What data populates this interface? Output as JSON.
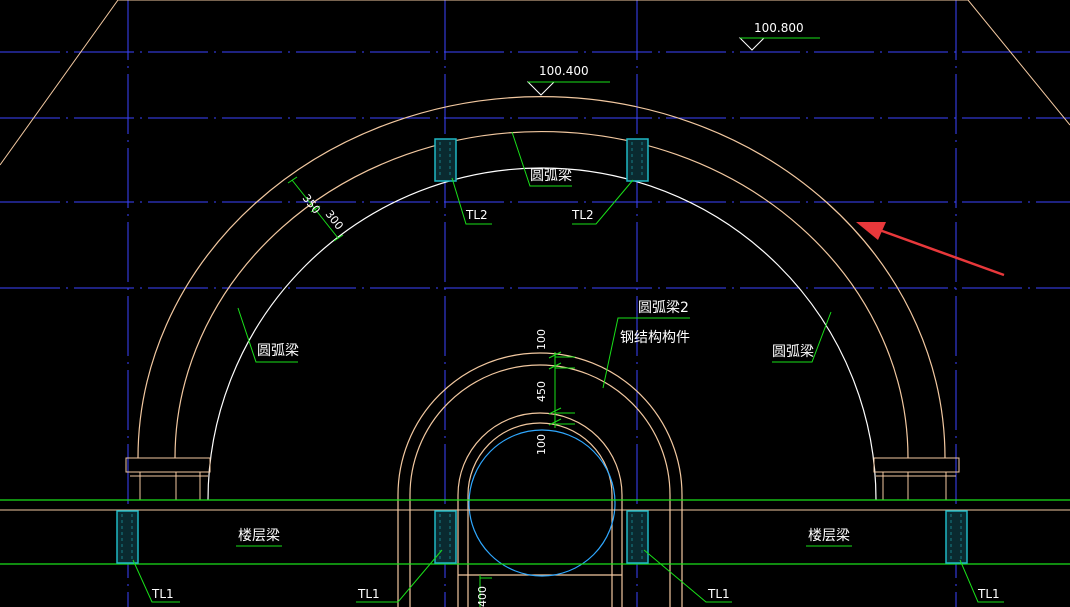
{
  "colors": {
    "background": "#000000",
    "axis": "#3b44ff",
    "outline": "#f2c8a0",
    "inner_arc": "#ffffff",
    "leader": "#19e019",
    "column_fill": "#1fb8c4",
    "circle": "#2fa8ff",
    "arrow": "#e8383b"
  },
  "elevations": {
    "top_right": "100.800",
    "top_center": "100.400"
  },
  "dimensions": {
    "arc_thickness_outer": "350",
    "arc_thickness_inner": "300",
    "inner_offset_top": "100",
    "inner_beam_height": "450",
    "inner_offset_bottom": "100",
    "lower_value": "400"
  },
  "labels": {
    "arc_beam_top": "圆弧梁",
    "arc_beam_left": "圆弧梁",
    "arc_beam_right": "圆弧梁",
    "arc_beam_2": "圆弧梁2",
    "steel_member": "钢结构构件",
    "tl2_left": "TL2",
    "tl2_right": "TL2",
    "floor_beam_left": "楼层梁",
    "floor_beam_right": "楼层梁",
    "tl1_a": "TL1",
    "tl1_b": "TL1",
    "tl1_c": "TL1",
    "tl1_d": "TL1"
  },
  "annotation": {
    "arrow": "red-pointer-arrow"
  }
}
